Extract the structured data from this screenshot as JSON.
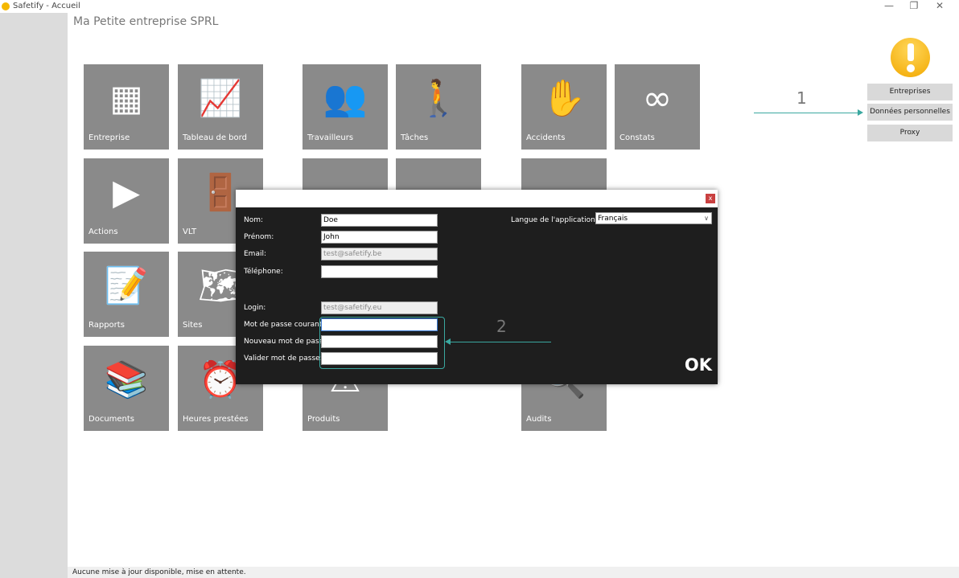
{
  "window": {
    "title": "Safetify - Accueil",
    "controls": [
      "minimize",
      "restore",
      "close"
    ]
  },
  "company": "Ma Petite entreprise SPRL",
  "tiles": [
    {
      "label": "Entreprise",
      "icon": "building-icon"
    },
    {
      "label": "Tableau de bord",
      "icon": "chart-icon"
    },
    {
      "label": "Travailleurs",
      "icon": "workers-icon"
    },
    {
      "label": "Tâches",
      "icon": "task-icon"
    },
    {
      "label": "Accidents",
      "icon": "hand-medical-icon"
    },
    {
      "label": "Constats",
      "icon": "binoculars-icon"
    },
    {
      "label": "Actions",
      "icon": "play-icon"
    },
    {
      "label": "VLT",
      "icon": "door-icon"
    },
    {
      "label": "Rapports",
      "icon": "report-icon"
    },
    {
      "label": "Sites",
      "icon": "map-icon"
    },
    {
      "label": "Documents",
      "icon": "books-icon"
    },
    {
      "label": "Heures prestées",
      "icon": "clock-icon"
    },
    {
      "label": "Produits",
      "icon": "hazard-icon"
    },
    {
      "label": "Audits",
      "icon": "magnifier-icon"
    }
  ],
  "side_buttons": [
    "Entreprises",
    "Données personnelles",
    "Proxy"
  ],
  "annotations": [
    "1",
    "2"
  ],
  "dialog": {
    "close": "x",
    "fields": [
      {
        "label": "Nom:",
        "value": "Doe"
      },
      {
        "label": "Prénom:",
        "value": "John"
      },
      {
        "label": "Email:",
        "value": "test@safetify.be"
      },
      {
        "label": "Téléphone:",
        "value": ""
      },
      {
        "label": "Login:",
        "value": "test@safetify.eu"
      },
      {
        "label": "Mot de passe courant:",
        "value": ""
      },
      {
        "label": "Nouveau mot de passe:",
        "value": ""
      },
      {
        "label": "Valider mot de passe:",
        "value": ""
      }
    ],
    "language_label": "Langue de l'application:",
    "language_value": "Français",
    "ok": "OK"
  },
  "status": "Aucune mise à jour disponible, mise en attente."
}
